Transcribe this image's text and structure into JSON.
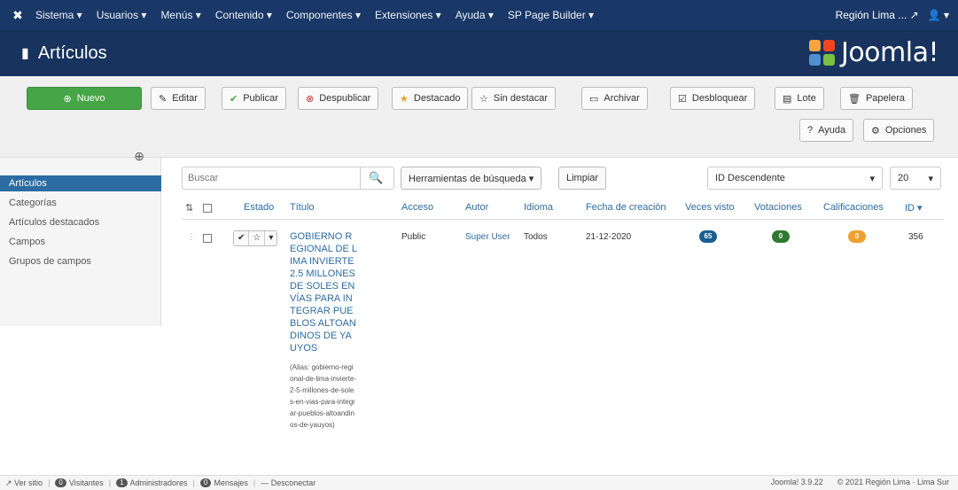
{
  "topnav": {
    "menu": [
      "Sistema ▾",
      "Usuarios ▾",
      "Menús ▾",
      "Contenido ▾",
      "Componentes ▾",
      "Extensiones ▾",
      "Ayuda ▾",
      "SP Page Builder ▾"
    ],
    "site": "Región Lima ... ↗",
    "user": "👤 ▾"
  },
  "header": {
    "title": "Artículos",
    "brand": "Joomla!"
  },
  "toolbar": {
    "new": "Nuevo",
    "edit": "Editar",
    "publish": "Publicar",
    "unpublish": "Despublicar",
    "feature": "Destacado",
    "unfeature": "Sin destacar",
    "archive": "Archivar",
    "unlock": "Desbloquear",
    "batch": "Lote",
    "trash": "Papelera",
    "help": "Ayuda",
    "options": "Opciones"
  },
  "sidebar": {
    "items": [
      "Artículos",
      "Categorías",
      "Artículos destacados",
      "Campos",
      "Grupos de campos"
    ]
  },
  "filters": {
    "search_placeholder": "Buscar",
    "tools": "Herramientas de búsqueda ▾",
    "clear": "Limpiar",
    "order": "ID Descendente",
    "limit": "20"
  },
  "table": {
    "headers": [
      "Estado",
      "Título",
      "Acceso",
      "Autor",
      "Idioma",
      "Fecha de creación",
      "Veces visto",
      "Votaciones",
      "Calificaciones",
      "ID ▾"
    ],
    "rows": [
      {
        "title": "GOBIERNO REGIONAL DE LIMA INVIERTE 2.5 MILLONES DE SOLES EN VÍAS PARA INTEGRAR PUEBLOS ALTOANDINOS DE YAUYOS",
        "alias": "(Alias: gobierno-regional-de-lima-invierte-2-5-millones-de-soles-en-vias-para-integrar-pueblos-altoandinos-de-yauyos)",
        "access": "Public",
        "author": "Super User",
        "language": "Todos",
        "created": "21-12-2020",
        "hits": "65",
        "votes": "0",
        "ratings": "0",
        "id": "356"
      }
    ]
  },
  "statusbar": {
    "view_site": "Ver sitio",
    "visitors": "Visitantes",
    "admins": "Administradores",
    "messages": "Mensajes",
    "visitors_count": "0",
    "admins_count": "1",
    "messages_count": "0",
    "logout": "Desconectar",
    "version": "Joomla! 3.9.22",
    "copyright": "© 2021 Región Lima · Lima Sur"
  },
  "colors": {
    "nav": "#1a3867",
    "header": "#17335e",
    "new_button": "#46a546",
    "link": "#2d6ca2",
    "badge_hits": "#1a5f91",
    "badge_votes": "#2f7a2f",
    "badge_ratings": "#f0a030"
  }
}
